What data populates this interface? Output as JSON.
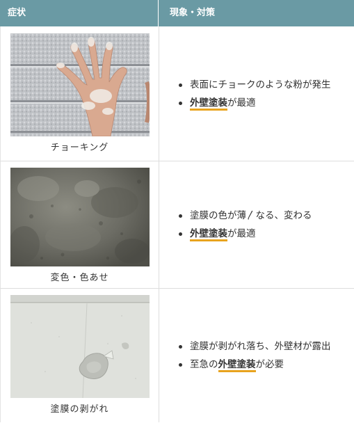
{
  "header": {
    "col_symptom": "症状",
    "col_remedy": "現象・対策"
  },
  "rows": [
    {
      "caption": "チョーキング",
      "image": "chalking-hand-on-siding-photo",
      "bullets": [
        {
          "text": "表面にチョークのような粉が発生"
        },
        {
          "pre": "",
          "highlight": "外壁塗装",
          "post": "が最適"
        }
      ]
    },
    {
      "caption": "変色・色あせ",
      "image": "discolored-concrete-wall-photo",
      "bullets": [
        {
          "text": "塗膜の色が薄〳なる、変わる"
        },
        {
          "pre": "",
          "highlight": "外壁塗装",
          "post": "が最適"
        }
      ]
    },
    {
      "caption": "塗膜の剥がれ",
      "image": "peeling-paint-wall-photo",
      "bullets": [
        {
          "text": "塗膜が剥がれ落ち、外壁材が露出"
        },
        {
          "pre": "至急の",
          "highlight": "外壁塗装",
          "post": "が必要"
        }
      ]
    }
  ],
  "colors": {
    "header_bg": "#6a9aa4",
    "highlight_underline": "#e8a31e"
  }
}
